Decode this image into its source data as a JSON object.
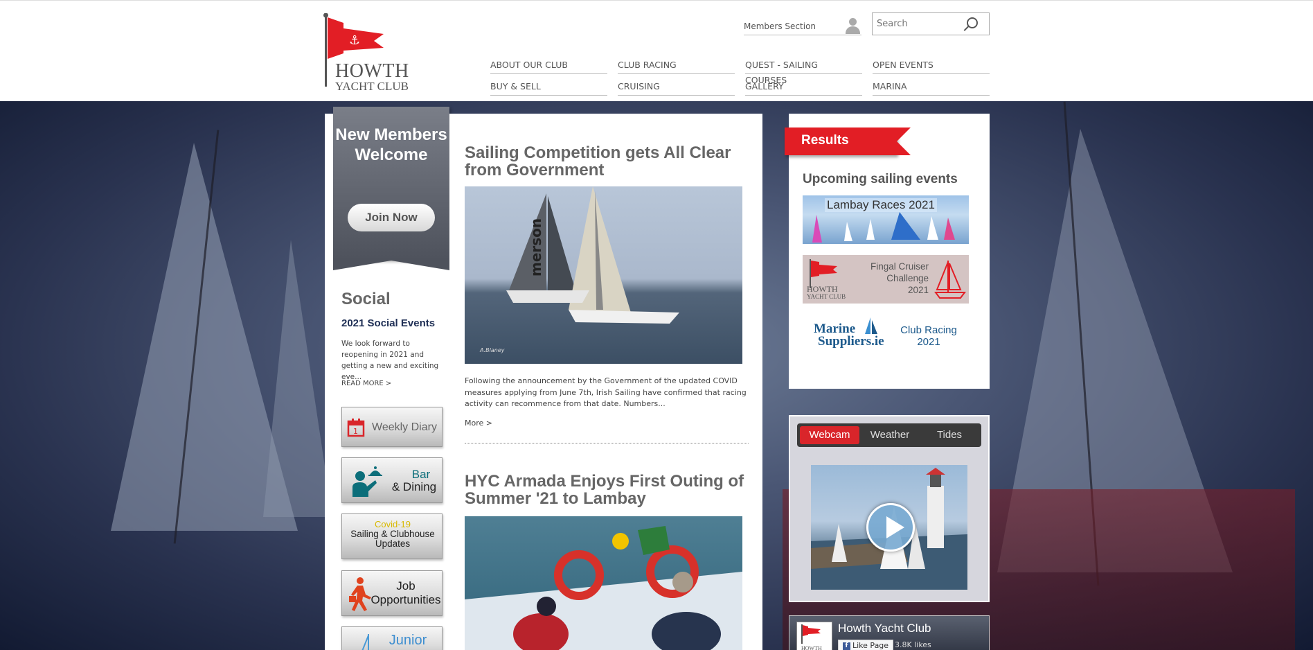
{
  "header": {
    "logo_line1": "HOWTH",
    "logo_line2": "YACHT CLUB",
    "members_label": "Members Section",
    "search_placeholder": "Search",
    "nav": [
      "ABOUT OUR CLUB",
      "CLUB RACING",
      "QUEST - SAILING COURSES",
      "OPEN EVENTS",
      "BUY & SELL",
      "CRUISING",
      "GALLERY",
      "MARINA"
    ]
  },
  "left": {
    "banner_title": "New Members Welcome",
    "join_label": "Join Now",
    "social_title": "Social",
    "social_subtitle": "2021 Social Events",
    "social_text": "We look forward to reopening in 2021 and getting a new and exciting eve...",
    "read_more": "READ MORE >",
    "buttons": {
      "diary": "Weekly Diary",
      "bar_line1": "Bar",
      "bar_line2": "& Dining",
      "covid_line1": "Covid-19",
      "covid_line2": "Sailing & Clubhouse",
      "covid_line3": "Updates",
      "job_line1": "Job",
      "job_line2": "Opportunities",
      "junior": "Junior"
    }
  },
  "articles": [
    {
      "title": "Sailing Competition gets All Clear from Government",
      "text": "Following the announcement by the Government of the updated COVID measures applying from June 7th, Irish Sailing have confirmed that racing activity can recommence from that date.  Numbers...",
      "more": "More >",
      "photo_credit": "A.Blaney"
    },
    {
      "title": "HYC Armada Enjoys First Outing of Summer '21 to Lambay"
    }
  ],
  "right": {
    "results_label": "Results",
    "upcoming_title": "Upcoming sailing events",
    "events": {
      "lambay": "Lambay Races 2021",
      "fingal_line1": "Fingal Cruiser",
      "fingal_line2": "Challenge",
      "fingal_line3": "2021",
      "marine_line1": "Marine",
      "marine_line2": "Suppliers.ie",
      "club_racing_line1": "Club Racing",
      "club_racing_line2": "2021",
      "logo_line1": "HOWTH",
      "logo_line2": "YACHT CLUB"
    }
  },
  "widget": {
    "tabs": [
      "Webcam",
      "Weather",
      "Tides"
    ],
    "active_tab": "Webcam"
  },
  "facebook": {
    "page_name": "Howth Yacht Club",
    "like_label": "Like Page",
    "likes": "3.8K likes"
  },
  "colors": {
    "brand_red": "#e21e25",
    "navy": "#1f2f55"
  }
}
